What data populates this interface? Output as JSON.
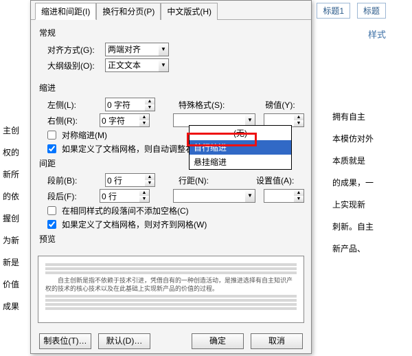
{
  "bg": {
    "lines": [
      "主创",
      "权的",
      "新所",
      "的依",
      "握创",
      "为新",
      "新是",
      "价值",
      "成果"
    ],
    "right_lines": [
      "",
      "",
      "拥有自主",
      "",
      "本模仿对外",
      "本质就是",
      "的成果，一",
      "",
      "上实现新",
      "刺新。自主",
      "新产品、"
    ]
  },
  "styles_label": "样式",
  "chip1": "标题1",
  "chip2": "标题",
  "tabs": {
    "t1": "缩进和间距(I)",
    "t2": "换行和分页(P)",
    "t3": "中文版式(H)"
  },
  "groups": {
    "general": "常规",
    "indent": "缩进",
    "spacing": "间距",
    "preview": "预览"
  },
  "labels": {
    "align": "对齐方式(G):",
    "outline": "大纲级别(O):",
    "left": "左侧(L):",
    "right": "右侧(R):",
    "special": "特殊格式(S):",
    "by": "磅值(Y):",
    "mirror": "对称缩进(M)",
    "grid_indent": "如果定义了文档网格，则自动调整右缩进(D)",
    "before": "段前(B):",
    "after": "段后(F):",
    "line": "行距(N):",
    "at": "设置值(A):",
    "no_space": "在相同样式的段落间不添加空格(C)",
    "grid_align": "如果定义了文档网格，则对齐到网格(W)"
  },
  "values": {
    "align": "两端对齐",
    "outline": "正文文本",
    "left": "0 字符",
    "right": "0 字符",
    "special": "(无)",
    "by": "",
    "before": "0 行",
    "after": "0 行",
    "line": "",
    "at": ""
  },
  "dropdown": {
    "opt0": "(无)",
    "opt1": "首行缩进",
    "opt2": "悬挂缩进"
  },
  "preview_text": "自主创新是指不依赖于技术引进，凭借自有的一种创造活动，是推进选择有自主知识产权的技术的核心技术以及在此基础上实现新产品的价值的过程。",
  "buttons": {
    "tabs": "制表位(T)…",
    "default": "默认(D)…",
    "ok": "确定",
    "cancel": "取消"
  }
}
